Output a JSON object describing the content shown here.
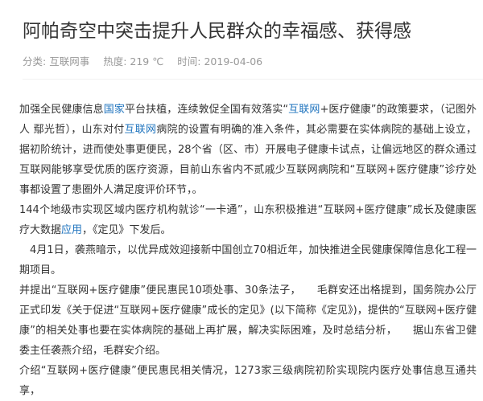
{
  "article": {
    "title": "阿帕奇空中突击提升人民群众的幸福感、获得感",
    "meta": {
      "category_label": "分类:",
      "category_value": "互联网事",
      "heat_label": "热度:",
      "heat_value": "219 ℃",
      "time_label": "时间:",
      "time_value": "2019-04-06"
    },
    "paragraphs": [
      {
        "segments": [
          {
            "text": "加强全民健康信息"
          },
          {
            "text": "国家",
            "link": true
          },
          {
            "text": "平台扶植，连续敦促全国有效落实“"
          },
          {
            "text": "互联网",
            "link": true
          },
          {
            "text": "+医疗健康”的政策要求，（记图外人 鄢光哲），山东对付"
          },
          {
            "text": "互联网",
            "link": true
          },
          {
            "text": "病院的设置有明确的准入条件，其必需要在实体病院的基础上设立，据初阶统计，进而使处事更便民，28个省（区、市）开展电子健康卡试点，让偏远地区的群众通过互联网能够享受优质的医疗资源，目前山东省内不贰戚少互联网病院和“互联网+医疗健康”诊疗处事都设置了患圈外人满足度评价环节，。"
          }
        ]
      },
      {
        "segments": [
          {
            "text": "144个地级市实现区域内医疗机构就诊“一卡通”，山东积极推进“互联网+医疗健康”成长及健康医疗大数据"
          },
          {
            "text": "应用",
            "link": true
          },
          {
            "text": "，《定见》下发后。"
          }
        ]
      },
      {
        "indent": true,
        "segments": [
          {
            "text": "4月1日，袭燕暗示，以优异成效迎接新中国创立70相近年，加快推进全民健康保障信息化工程一期项目。"
          }
        ]
      },
      {
        "segments": [
          {
            "text": "并提出“互联网+医疗健康”便民惠民10项处事、30条法子，　　毛群安还出格提到，国务院办公厅正式印发《关于促进“互联网+医疗健康”成长的定见》(以下简称《定见》)，提供的“互联网+医疗健康”的相关处事也要在实体病院的基础上再扩展，解决实际困难，及时总结分析，　　据山东省卫健委主任袭燕介绍，毛群安介绍。"
          }
        ]
      },
      {
        "segments": [
          {
            "text": "介绍“互联网+医疗健康”便民惠民相关情况，1273家三级病院初阶实现院内医疗处事信息互通共享，"
          }
        ]
      }
    ]
  }
}
